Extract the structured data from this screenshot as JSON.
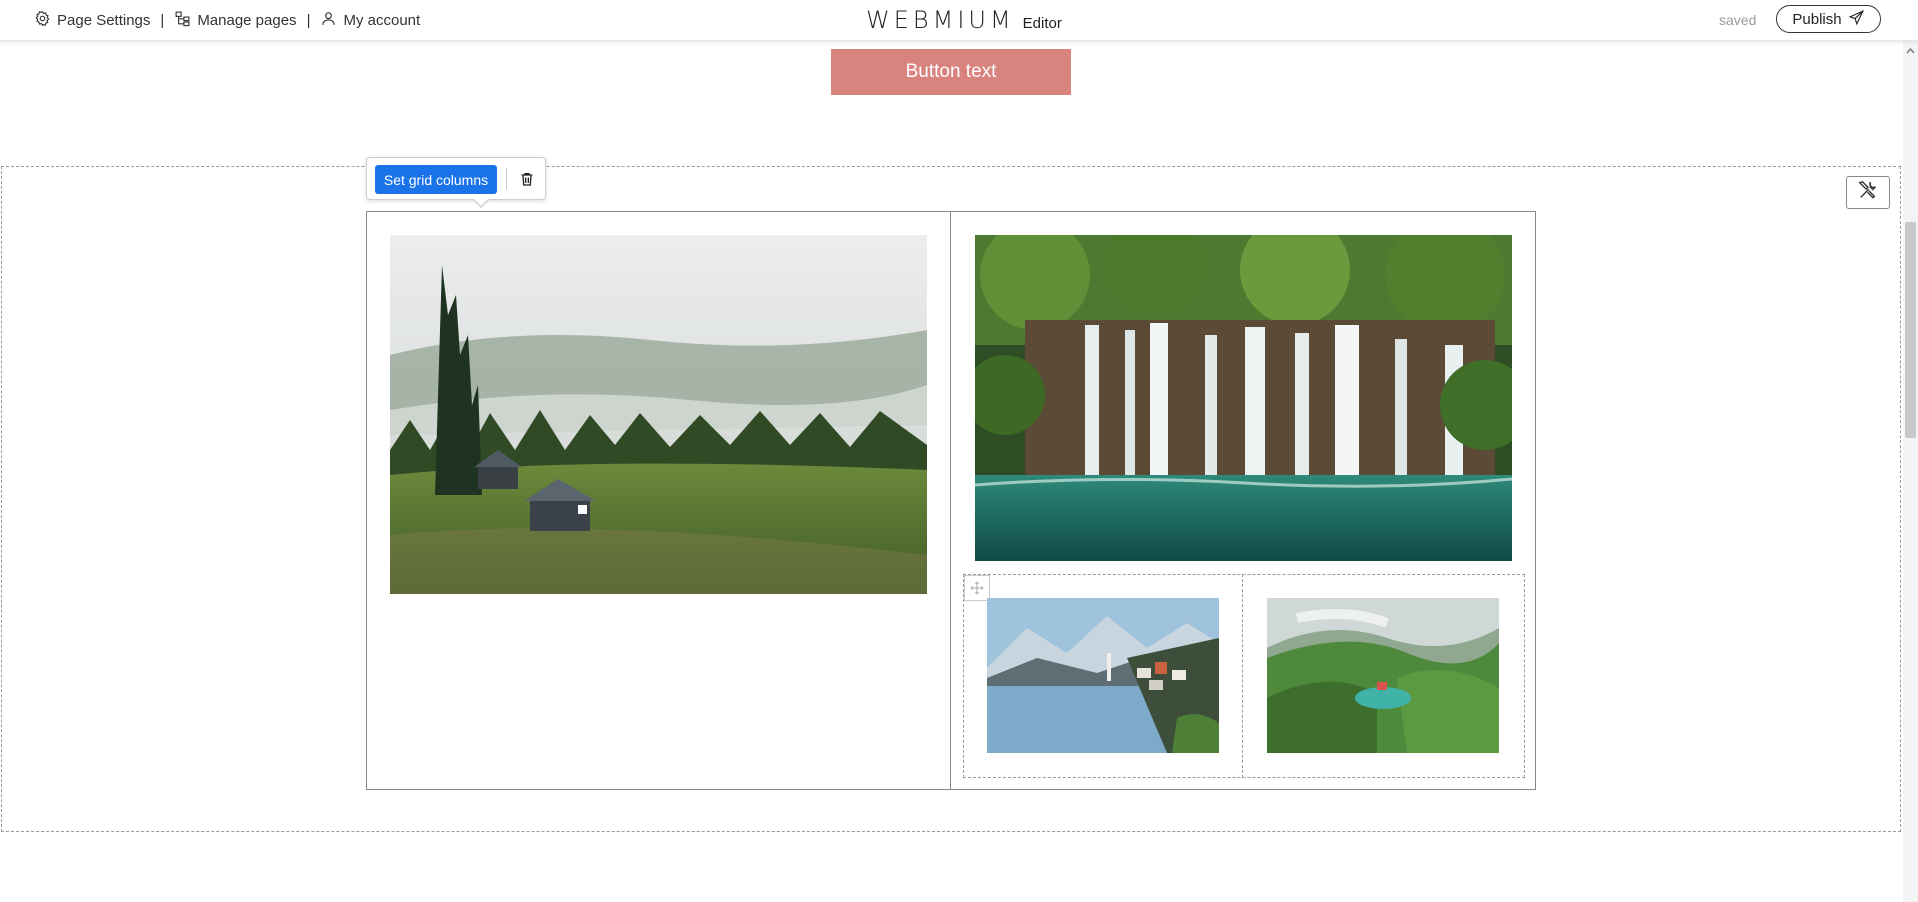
{
  "header": {
    "page_settings": "Page Settings",
    "manage_pages": "Manage pages",
    "my_account": "My account",
    "separator": "|",
    "brand_logo": "WEBMIUM",
    "brand_sub": "Editor",
    "status": "saved",
    "publish": "Publish"
  },
  "canvas": {
    "cta_button": "Button text",
    "cta_color": "#d9837f",
    "grid_toolbar": {
      "set_columns": "Set grid columns",
      "delete_icon": "trash-icon"
    },
    "section_settings_icon": "tools-icon",
    "images": [
      {
        "name": "forest-cabin-image",
        "scene": "misty forest with log cabins"
      },
      {
        "name": "waterfall-image",
        "scene": "waterfalls over turquoise lake"
      },
      {
        "name": "lake-village-image",
        "scene": "mountain lake village"
      },
      {
        "name": "mountain-valley-image",
        "scene": "green mountain valley with lake"
      }
    ]
  },
  "accent_color": "#1a73e8"
}
